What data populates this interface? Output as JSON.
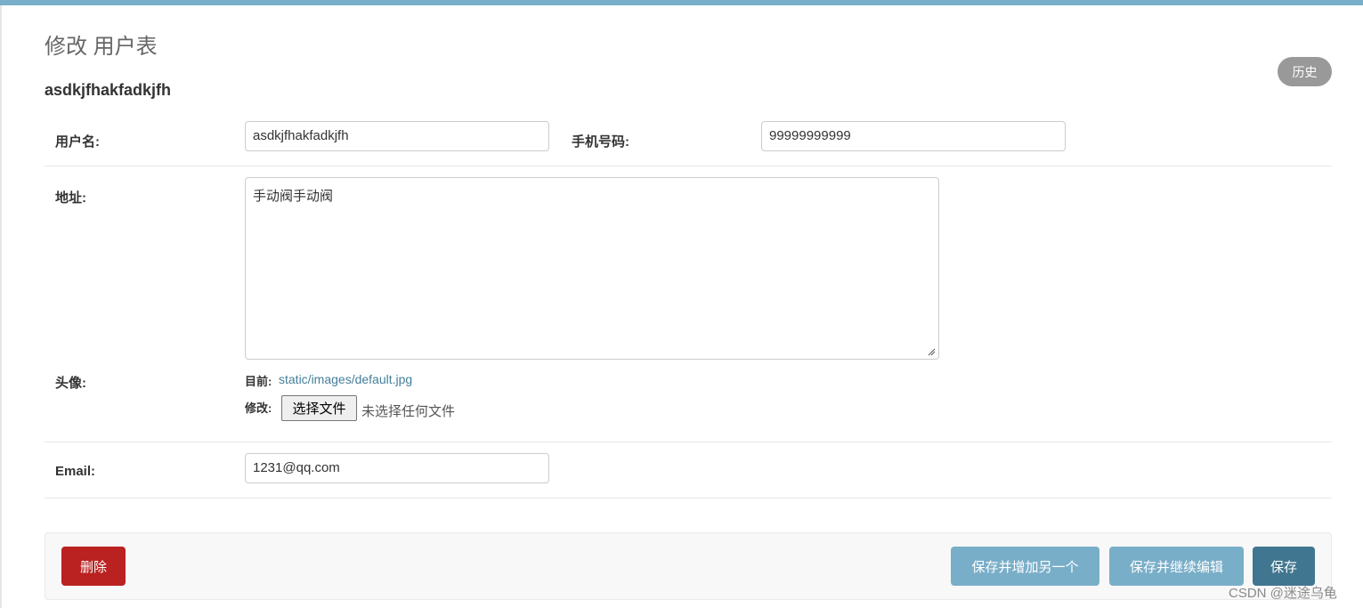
{
  "page": {
    "title": "修改 用户表",
    "object_title": "asdkjfhakfadkjfh",
    "history_label": "历史"
  },
  "fields": {
    "username": {
      "label": "用户名:",
      "value": "asdkjfhakfadkjfh"
    },
    "phone": {
      "label": "手机号码:",
      "value": "99999999999"
    },
    "address": {
      "label": "地址:",
      "value": "手动阀手动阀"
    },
    "avatar": {
      "label": "头像:",
      "current_label": "目前:",
      "current_value": "static/images/default.jpg",
      "change_label": "修改:",
      "choose_button": "选择文件",
      "no_file_text": "未选择任何文件"
    },
    "email": {
      "label": "Email:",
      "value": "1231@qq.com"
    }
  },
  "actions": {
    "delete": "删除",
    "save_add_another": "保存并增加另一个",
    "save_continue": "保存并继续编辑",
    "save": "保存"
  },
  "watermark": "CSDN @迷途乌龟",
  "colors": {
    "accent": "#79aec8",
    "primary": "#417690",
    "danger": "#ba2121",
    "link": "#447e9b"
  }
}
